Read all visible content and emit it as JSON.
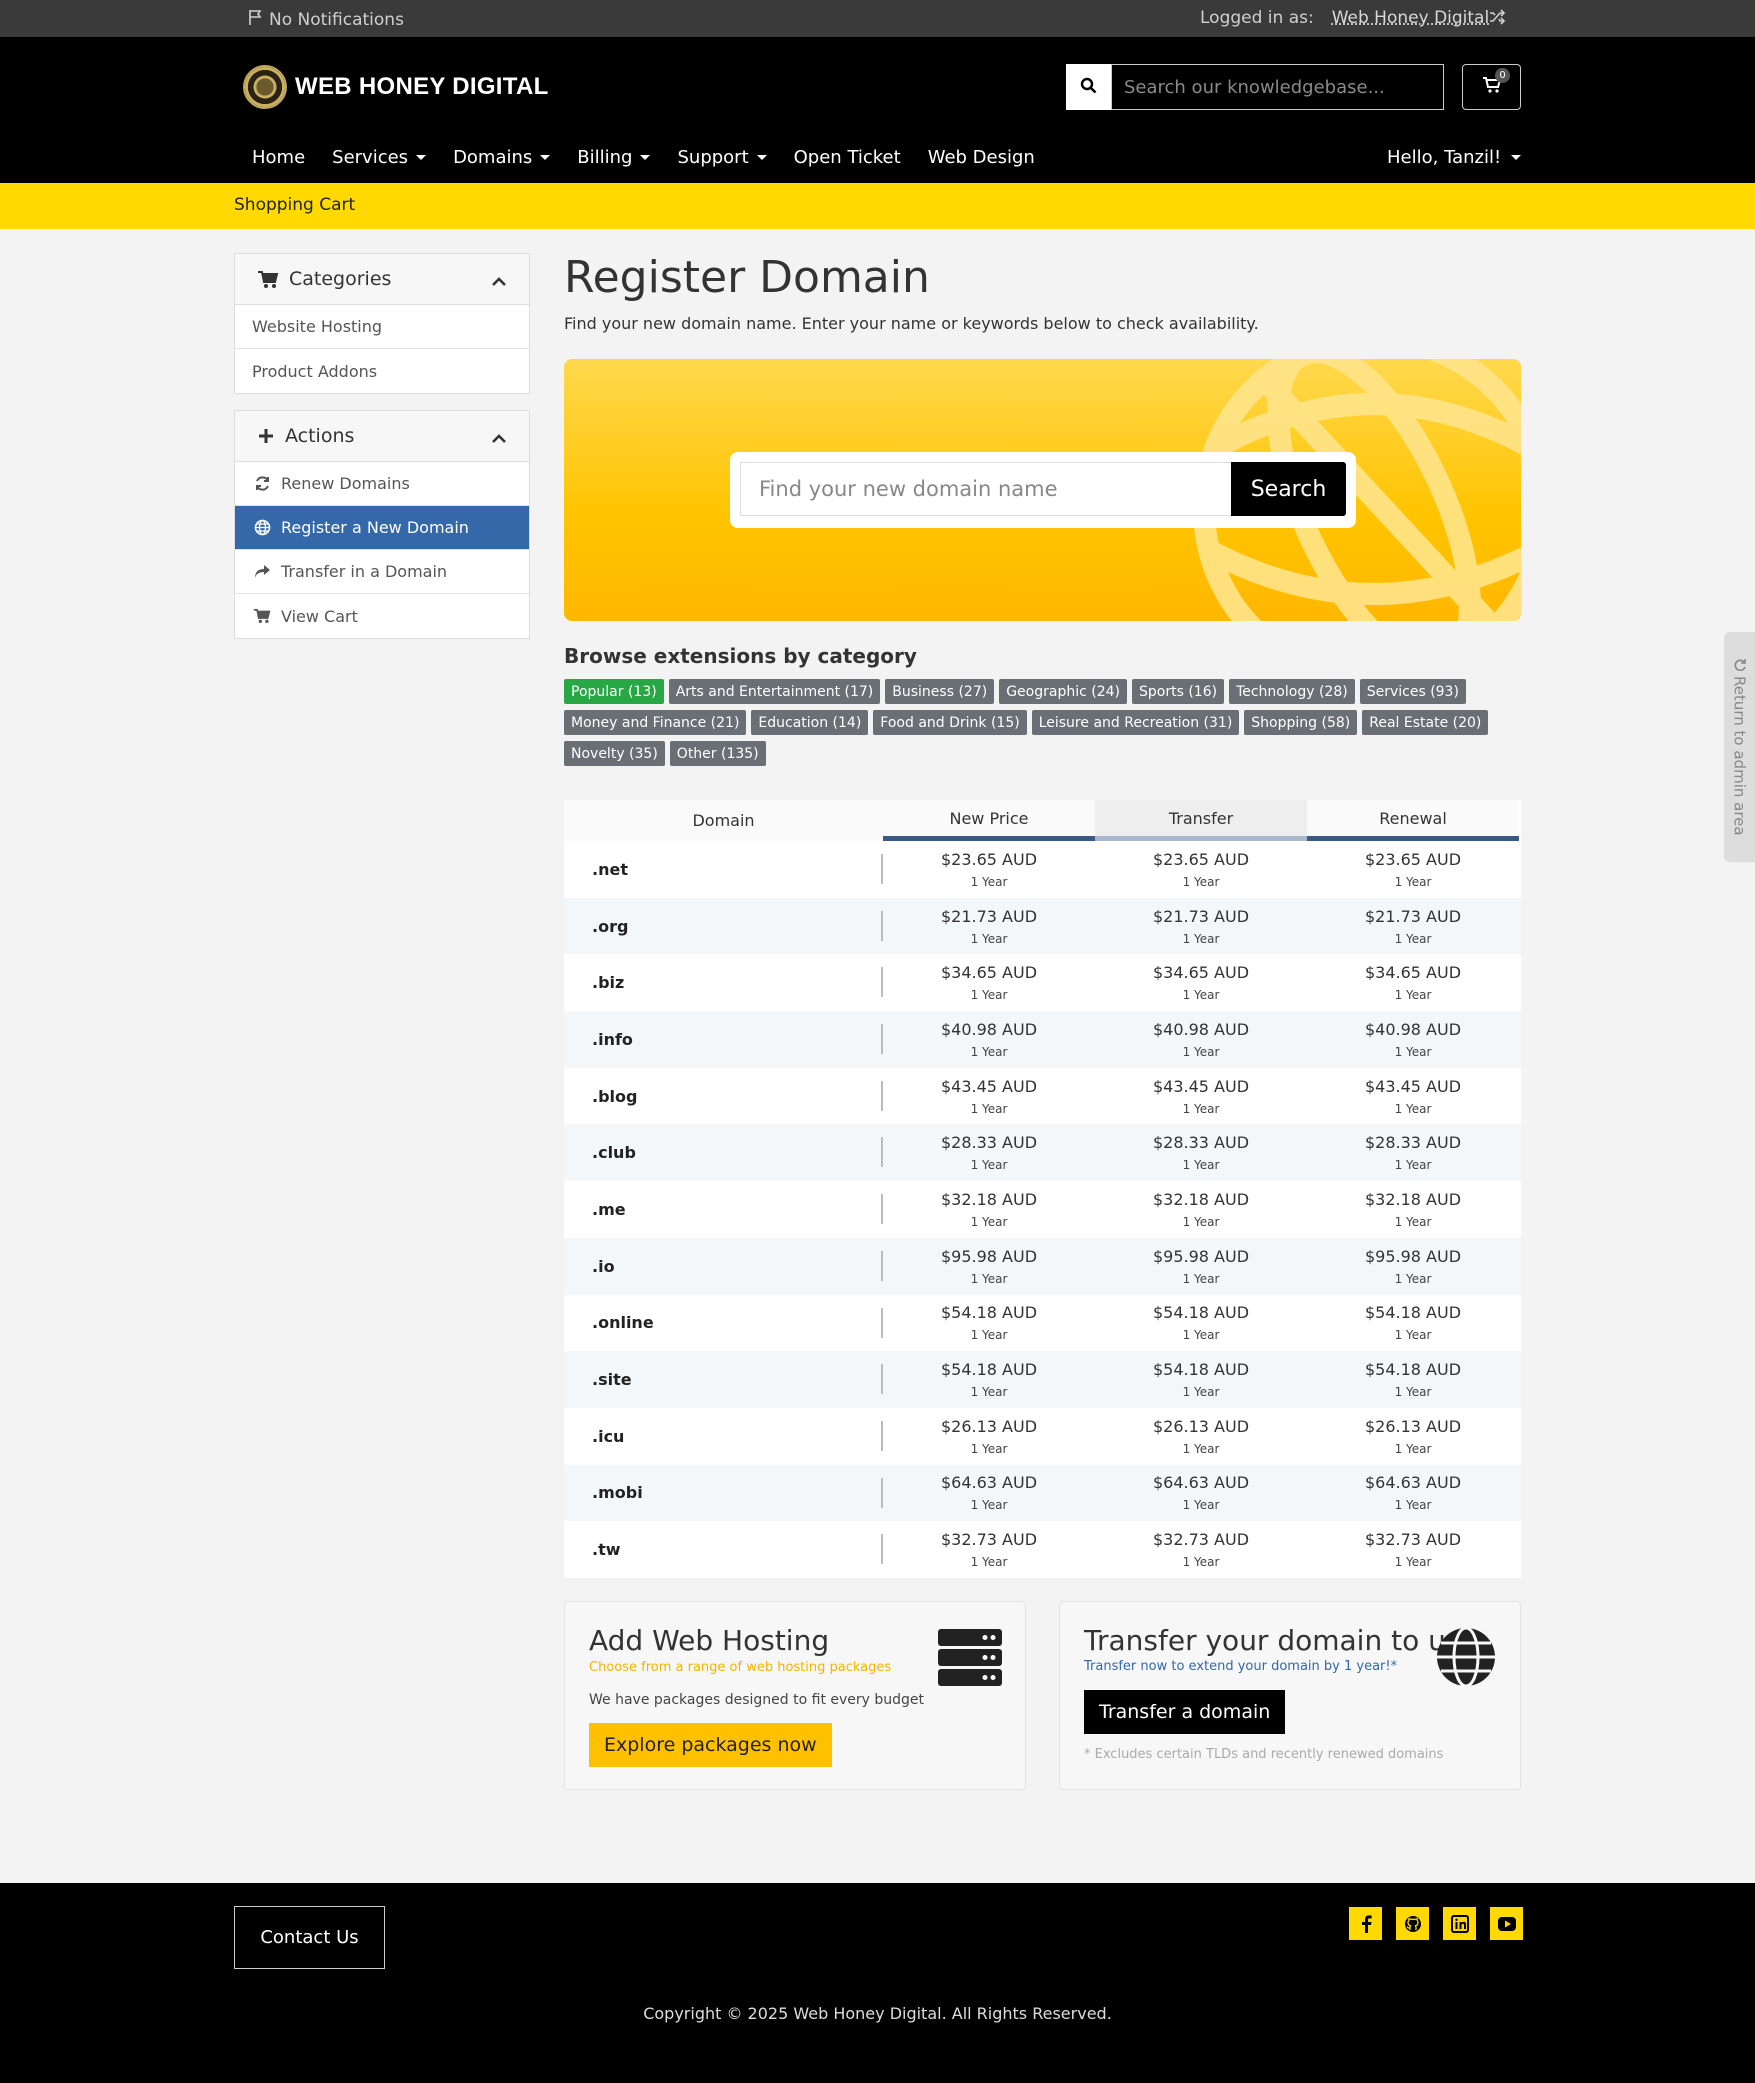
{
  "topbar": {
    "notifications": "No Notifications",
    "logged_in_label": "Logged in as:",
    "logged_in_user": "Web Honey Digital"
  },
  "header": {
    "brand": "WEB HONEY DIGITAL",
    "search_placeholder": "Search our knowledgebase...",
    "cart_count": "0",
    "nav": [
      "Home",
      "Services",
      "Domains",
      "Billing",
      "Support",
      "Open Ticket",
      "Web Design"
    ],
    "greeting": "Hello, Tanzil!"
  },
  "breadcrumb": "Shopping Cart",
  "sidebar": {
    "categories_title": "Categories",
    "categories": [
      "Website Hosting",
      "Product Addons"
    ],
    "actions_title": "Actions",
    "actions": [
      "Renew Domains",
      "Register a New Domain",
      "Transfer in a Domain",
      "View Cart"
    ]
  },
  "main": {
    "title": "Register Domain",
    "subtitle": "Find your new domain name. Enter your name or keywords below to check availability.",
    "search_placeholder": "Find your new domain name",
    "search_button": "Search",
    "browse_title": "Browse extensions by category",
    "tag_rows": [
      [
        "Popular (13)",
        "Arts and Entertainment (17)",
        "Business (27)",
        "Geographic (24)",
        "Sports (16)",
        "Technology (28)",
        "Services (93)"
      ],
      [
        "Money and Finance (21)",
        "Education (14)",
        "Food and Drink (15)",
        "Leisure and Recreation (31)",
        "Shopping (58)",
        "Real Estate (20)"
      ],
      [
        "Novelty (35)",
        "Other (135)"
      ]
    ]
  },
  "pricing": {
    "headers": [
      "Domain",
      "New Price",
      "Transfer",
      "Renewal"
    ],
    "period": "1 Year",
    "rows": [
      {
        "tld": ".net",
        "price": "$23.65 AUD"
      },
      {
        "tld": ".org",
        "price": "$21.73 AUD"
      },
      {
        "tld": ".biz",
        "price": "$34.65 AUD"
      },
      {
        "tld": ".info",
        "price": "$40.98 AUD"
      },
      {
        "tld": ".blog",
        "price": "$43.45 AUD"
      },
      {
        "tld": ".club",
        "price": "$28.33 AUD"
      },
      {
        "tld": ".me",
        "price": "$32.18 AUD"
      },
      {
        "tld": ".io",
        "price": "$95.98 AUD"
      },
      {
        "tld": ".online",
        "price": "$54.18 AUD"
      },
      {
        "tld": ".site",
        "price": "$54.18 AUD"
      },
      {
        "tld": ".icu",
        "price": "$26.13 AUD"
      },
      {
        "tld": ".mobi",
        "price": "$64.63 AUD"
      },
      {
        "tld": ".tw",
        "price": "$32.73 AUD"
      }
    ]
  },
  "hosting_card": {
    "title": "Add Web Hosting",
    "sub": "Choose from a range of web hosting packages",
    "body": "We have packages designed to fit every budget",
    "button": "Explore packages now"
  },
  "transfer_card": {
    "title": "Transfer your domain to us",
    "sub": "Transfer now to extend your domain by 1 year!*",
    "button": "Transfer a domain",
    "note": "* Excludes certain TLDs and recently renewed domains"
  },
  "admin_tab": "Return to admin area",
  "footer": {
    "contact": "Contact Us",
    "copyright": "Copyright © 2025 Web Honey Digital. All Rights Reserved."
  },
  "colors": {
    "accent_yellow": "#ffd900",
    "active_blue": "#3468a8",
    "popular_green": "#28a745",
    "table_header_blue": "#3b5a83"
  }
}
